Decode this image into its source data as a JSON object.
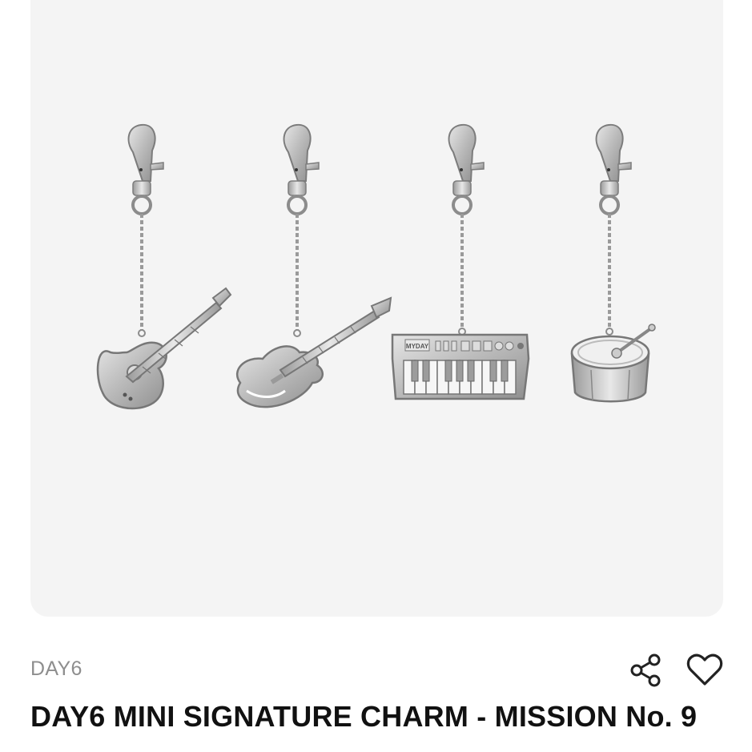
{
  "product": {
    "brand": "DAY6",
    "title": "DAY6 MINI SIGNATURE CHARM - MISSION No. 9",
    "keyboard_logo": "MYDAY"
  },
  "icons": {
    "share": "share-icon",
    "favorite": "heart-icon"
  },
  "colors": {
    "image_background": "#f4f4f4",
    "brand_text": "#8e8e8e",
    "title_text": "#111111",
    "icon": "#222222",
    "metal": "#b9b9b9"
  }
}
